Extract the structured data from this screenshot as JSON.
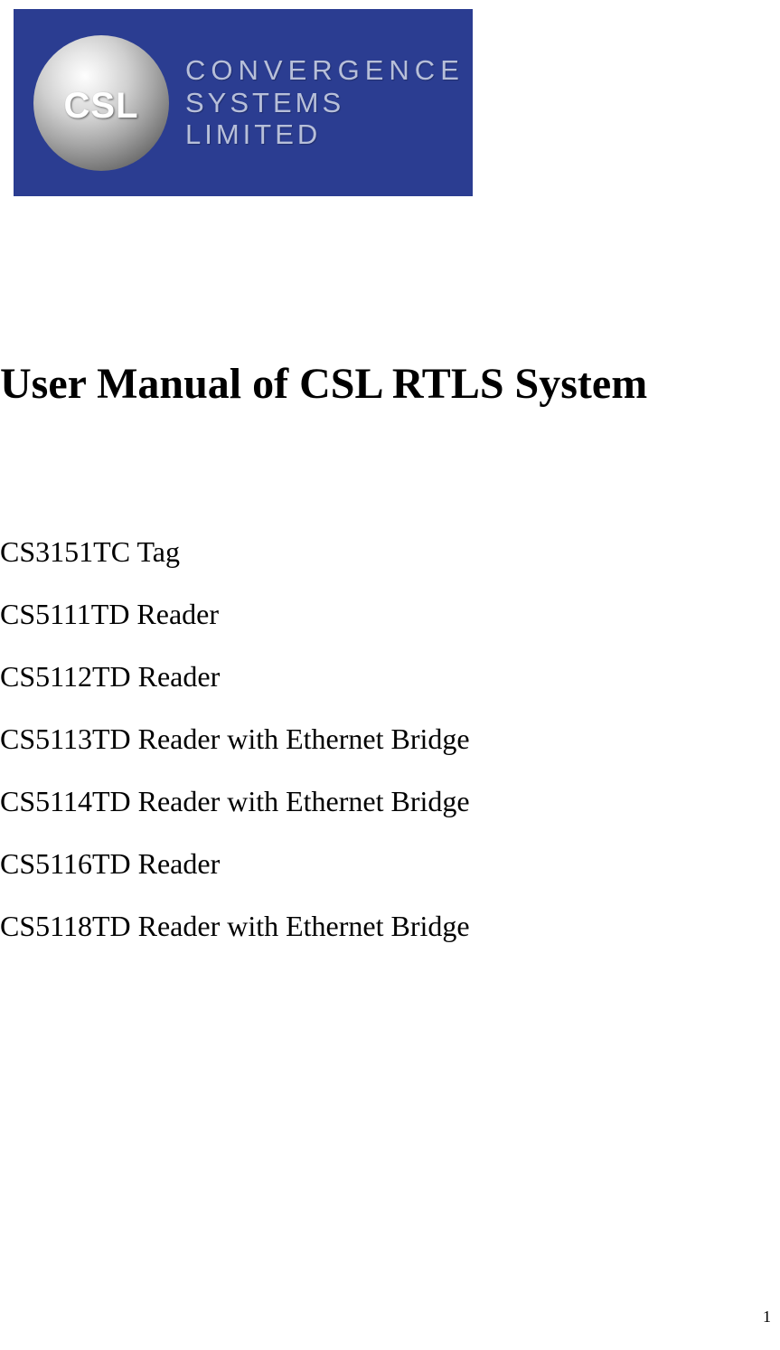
{
  "logo": {
    "sphere_text": "CSL",
    "line1": "CONVERGENCE",
    "line2": "SYSTEMS LIMITED"
  },
  "title": "User Manual of CSL RTLS System",
  "products": [
    "CS3151TC Tag",
    "CS5111TD Reader",
    "CS5112TD Reader",
    "CS5113TD Reader with Ethernet Bridge",
    "CS5114TD Reader with Ethernet Bridge",
    "CS5116TD Reader",
    "CS5118TD Reader with Ethernet Bridge"
  ],
  "page_number": "1"
}
